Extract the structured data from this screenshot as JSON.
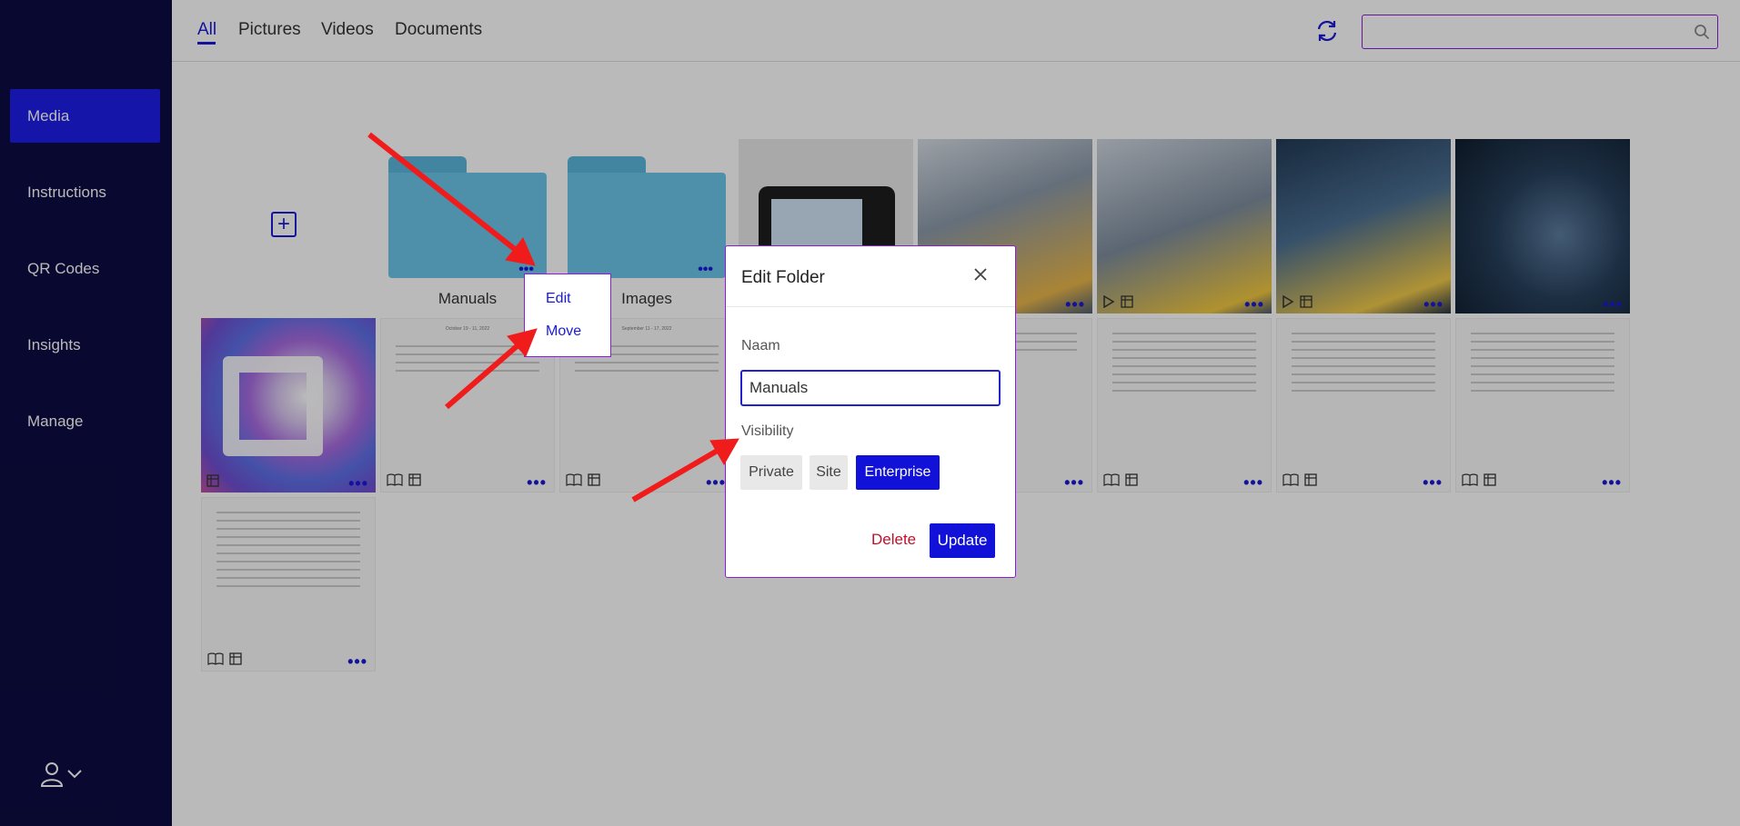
{
  "sidebar": {
    "items": [
      {
        "label": "Media",
        "active": true
      },
      {
        "label": "Instructions",
        "active": false
      },
      {
        "label": "QR Codes",
        "active": false
      },
      {
        "label": "Insights",
        "active": false
      },
      {
        "label": "Manage",
        "active": false
      }
    ],
    "user_icon": "user-icon",
    "user_chevron": "chevron-down-icon"
  },
  "topbar": {
    "tabs": [
      {
        "label": "All",
        "active": true
      },
      {
        "label": "Pictures",
        "active": false
      },
      {
        "label": "Videos",
        "active": false
      },
      {
        "label": "Documents",
        "active": false
      }
    ],
    "refresh_icon": "refresh-icon",
    "search": {
      "value": "",
      "placeholder": "",
      "icon": "search-icon"
    }
  },
  "grid": {
    "add_icon": "plus-icon",
    "folders": [
      {
        "label": "Manuals"
      },
      {
        "label": "Images"
      }
    ],
    "documents": [
      {
        "date": "October 19 - 11, 2022"
      },
      {
        "date": "September 11 - 17, 2022"
      }
    ]
  },
  "context_menu": {
    "edit_label": "Edit",
    "move_label": "Move"
  },
  "modal": {
    "title": "Edit Folder",
    "close_icon": "close-icon",
    "name_label": "Naam",
    "name_value": "Manuals",
    "visibility_label": "Visibility",
    "visibility_options": [
      "Private",
      "Site",
      "Enterprise"
    ],
    "visibility_selected": "Enterprise",
    "delete_label": "Delete",
    "update_label": "Update"
  },
  "colors": {
    "sidebar_bg": "#0c0c42",
    "accent": "#1111d8",
    "modal_border": "#8e1bd8",
    "annotation_arrow": "#f01c1c",
    "delete_text": "#c0102a"
  }
}
